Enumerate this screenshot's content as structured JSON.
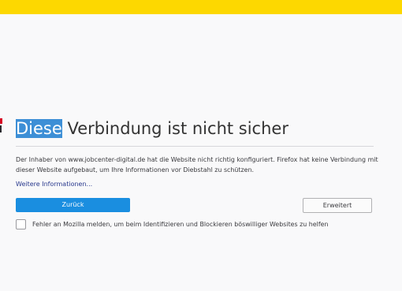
{
  "colors": {
    "top_bar": "#fdd800",
    "accent_button": "#1a8ee0",
    "link": "#2a3a8e",
    "selection": "#3d8fd6",
    "warning_red": "#d70022"
  },
  "error_page": {
    "title_selected": "Diese",
    "title_rest": " Verbindung ist nicht sicher",
    "description": "Der Inhaber von www.jobcenter-digital.de hat die Website nicht richtig konfiguriert. Firefox hat keine Verbindung mit dieser Website aufgebaut, um Ihre Informationen vor Diebstahl zu schützen.",
    "more_info_link": "Weitere Informationen...",
    "back_button": "Zurück",
    "advanced_button": "Erweitert",
    "report_checkbox_label": "Fehler an Mozilla melden, um beim Identifizieren und Blockieren böswilliger Websites zu helfen",
    "report_checked": false,
    "icon": "warning-icon"
  }
}
